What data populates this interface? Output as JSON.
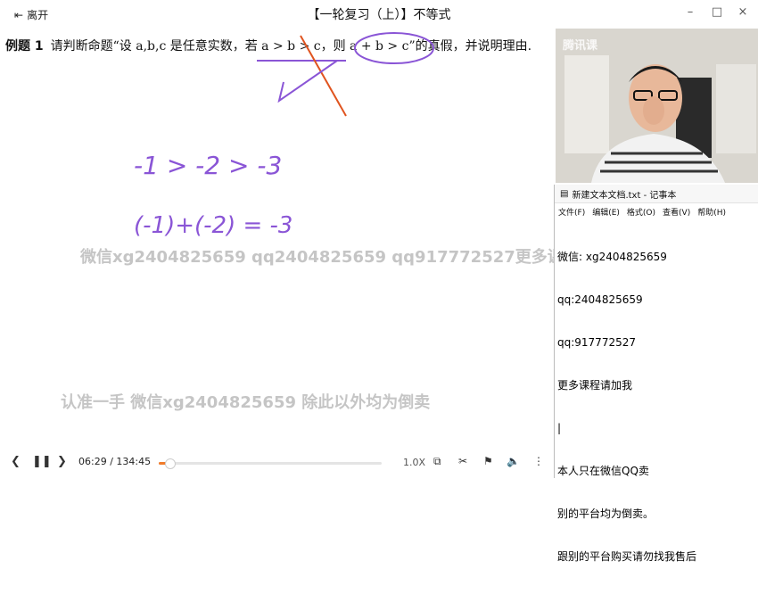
{
  "titlebar": {
    "leave_label": "离开",
    "title": "【一轮复习（上）】不等式",
    "minimize": "–",
    "maximize": "□",
    "close": "×"
  },
  "question": {
    "prefix": "例题 1",
    "text": "请判断命题“设 a,b,c 是任意实数，若 a > b > c，则 a + b > c”的真假，并说明理由."
  },
  "handwriting": {
    "line1": "-1 > -2 > -3",
    "line2": "(-1)+(-2) = -3"
  },
  "video": {
    "logo": "腾讯课"
  },
  "watermarks": {
    "line1": "微信xg2404825659 qq2404825659 qq917772527更多课程",
    "line2": "认准一手 微信xg2404825659 除此以外均为倒卖"
  },
  "notepad": {
    "title": "新建文本文档.txt - 记事本",
    "menu": [
      "文件(F)",
      "编辑(E)",
      "格式(O)",
      "查看(V)",
      "帮助(H)"
    ],
    "lines": [
      "微信: xg2404825659",
      "qq:2404825659",
      "qq:917772527",
      "更多课程请加我",
      "|",
      "本人只在微信QQ卖",
      "别的平台均为倒卖。",
      "跟别的平台购买请勿找我售后"
    ]
  },
  "player": {
    "time": "06:29 / 134:45",
    "progress_fraction": 0.048,
    "speed": "1.0X"
  },
  "colors": {
    "accent": "#f07c2b",
    "ink_purple": "#8a55d6",
    "ink_red": "#e0541f"
  }
}
